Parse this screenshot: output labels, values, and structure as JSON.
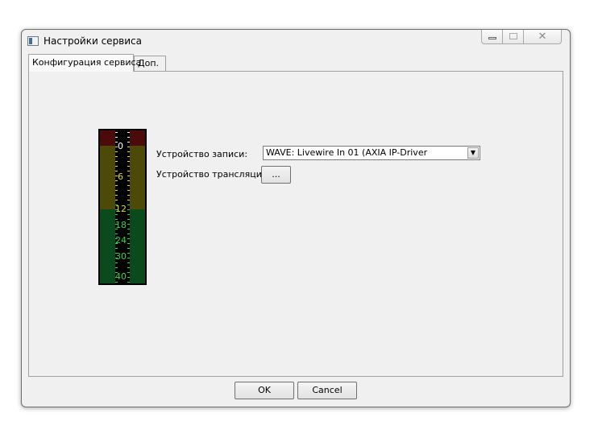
{
  "window": {
    "title": "Настройки сервиса",
    "controls": {
      "minimize": "minimize",
      "maximize": "maximize",
      "close": "✕"
    }
  },
  "tabs": [
    {
      "label": "Конфигурация сервиса",
      "active": true
    },
    {
      "label": "Доп.",
      "active": false
    }
  ],
  "meter": {
    "scale": [
      "0",
      "6",
      "12",
      "18",
      "24",
      "30",
      "40"
    ],
    "colors": {
      "red": "#4b0b0b",
      "amber": "#4d4a07",
      "green": "#0a4a1c"
    }
  },
  "form": {
    "record_label": "Устройство записи:",
    "record_value": "WAVE: Livewire In 01 (AXIA IP-Driver",
    "broadcast_label": "Устройство трансляции:",
    "broadcast_button": "..."
  },
  "buttons": {
    "ok": "OK",
    "cancel": "Cancel"
  }
}
